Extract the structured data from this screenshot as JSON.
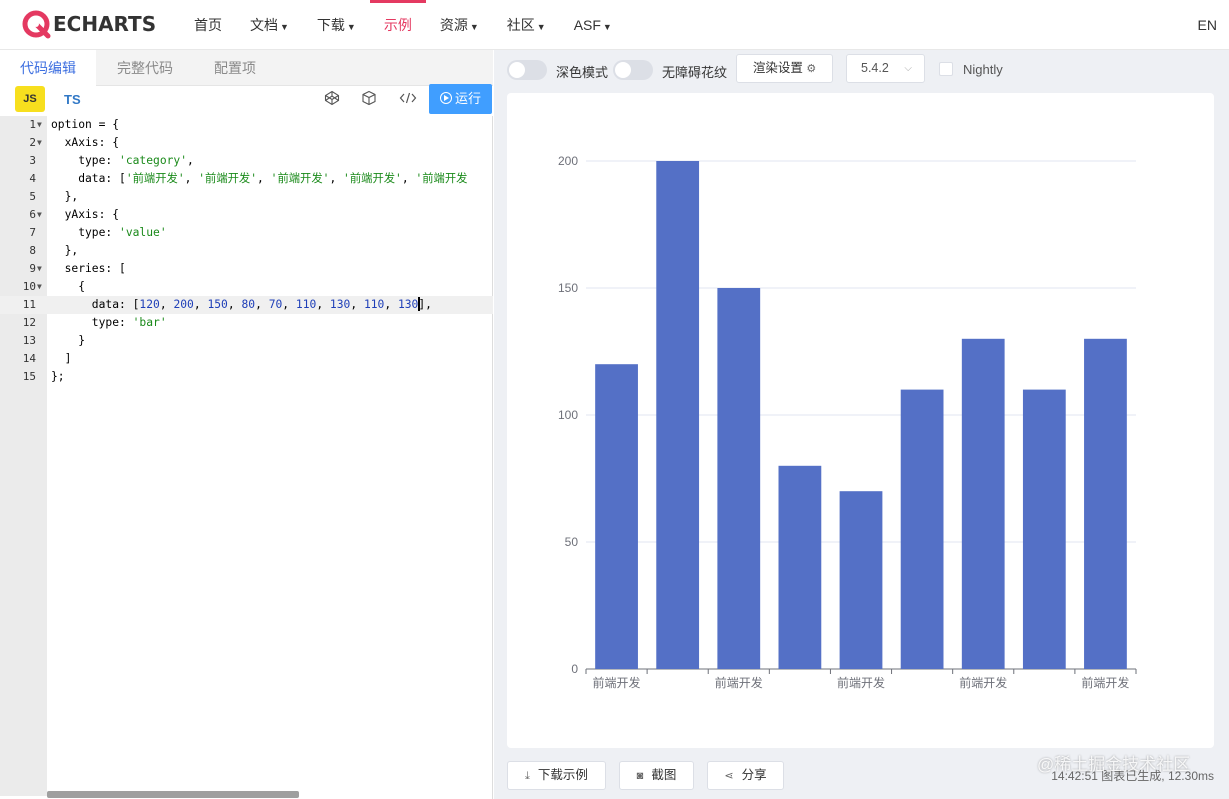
{
  "nav": {
    "logo_text": "ECHARTS",
    "items": [
      {
        "label": "首页",
        "caret": false,
        "active": false
      },
      {
        "label": "文档",
        "caret": true,
        "active": false
      },
      {
        "label": "下载",
        "caret": true,
        "active": false
      },
      {
        "label": "示例",
        "caret": false,
        "active": true
      },
      {
        "label": "资源",
        "caret": true,
        "active": false
      },
      {
        "label": "社区",
        "caret": true,
        "active": false
      },
      {
        "label": "ASF",
        "caret": true,
        "active": false
      }
    ],
    "lang": "EN",
    "accent_color": "#e43961"
  },
  "editor": {
    "tabs": [
      "代码编辑",
      "完整代码",
      "配置项"
    ],
    "active_tab": 0,
    "js_label": "JS",
    "ts_label": "TS",
    "tool_icons": [
      "codepen-icon",
      "codesandbox-icon",
      "embed-code-icon"
    ],
    "run_label": "运行",
    "active_line": 11,
    "lines": [
      "option = {",
      "  xAxis: {",
      "    type: 'category',",
      "    data: ['前端开发', '前端开发', '前端开发', '前端开发', '前端开发",
      "  },",
      "  yAxis: {",
      "    type: 'value'",
      "  },",
      "  series: [",
      "    {",
      "      data: [120, 200, 150, 80, 70, 110, 130, 110, 130],",
      "      type: 'bar'",
      "    }",
      "  ]",
      "};"
    ],
    "foldable_lines": [
      1,
      2,
      6,
      9,
      10
    ]
  },
  "preview": {
    "dark_mode_label": "深色模式",
    "accessibility_label": "无障碍花纹",
    "render_settings_label": "渲染设置",
    "version": "5.4.2",
    "nightly_label": "Nightly",
    "download_label": "下载示例",
    "screenshot_label": "截图",
    "share_label": "分享",
    "status_text": "14:42:51  图表已生成, 12.30ms",
    "watermark": "@稀土掘金技术社区"
  },
  "chart_data": {
    "type": "bar",
    "categories": [
      "前端开发",
      "前端开发",
      "前端开发",
      "前端开发",
      "前端开发",
      "前端开发",
      "前端开发",
      "前端开发",
      "前端开发"
    ],
    "values": [
      120,
      200,
      150,
      80,
      70,
      110,
      130,
      110,
      130
    ],
    "visible_category_labels": [
      0,
      2,
      4,
      6,
      8
    ],
    "y_ticks": [
      0,
      50,
      100,
      150,
      200
    ],
    "ylim": [
      0,
      200
    ],
    "bar_color": "#5470c6",
    "grid": true
  }
}
